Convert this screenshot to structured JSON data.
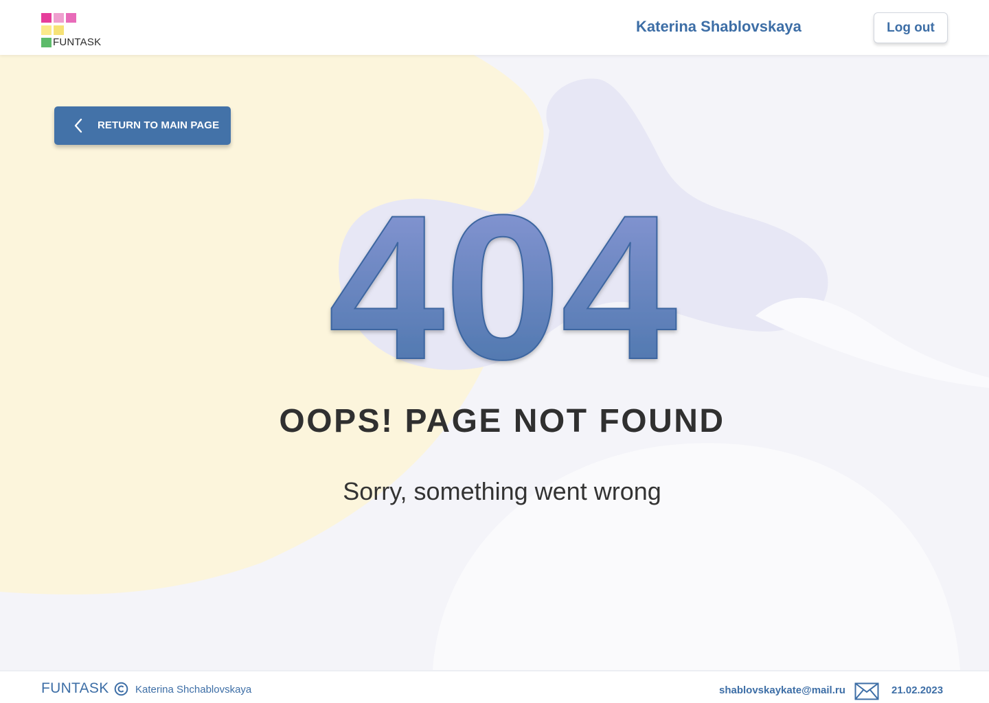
{
  "header": {
    "logo_text": "FUNTASK",
    "logo_colors": [
      "#e63d9b",
      "#ef9fcf",
      "#e86bb9",
      "#fbe98a",
      "#f6e276",
      "#5dbb6a"
    ],
    "user_name": "Katerina Shablovskaya",
    "logout_label": "Log out"
  },
  "main": {
    "return_label": "RETURN TO MAIN PAGE",
    "error_code": "404",
    "title": "OOPS! PAGE NOT FOUND",
    "subtitle": "Sorry, something went wrong"
  },
  "footer": {
    "brand": "FUNTASK",
    "author": "Katerina Shchablovskaya",
    "email": "shablovskaykate@mail.ru",
    "date": "21.02.2023"
  },
  "colors": {
    "accent": "#3d6ea6",
    "button": "#4372a8",
    "yellow_blob": "#fcf5dc",
    "lavender_blob": "#e7e7f5"
  }
}
